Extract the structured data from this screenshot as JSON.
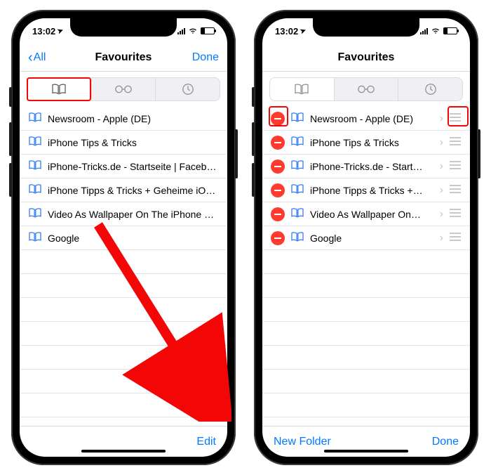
{
  "status": {
    "time": "13:02",
    "location_arrow": "➤"
  },
  "colors": {
    "tint": "#007aff",
    "delete": "#ff3b30",
    "highlight": "#f30606"
  },
  "left_phone": {
    "nav": {
      "back": "All",
      "title": "Favourites",
      "done": "Done"
    },
    "tabs": [
      "bookmarks",
      "reading-list",
      "history"
    ],
    "items": [
      {
        "title": "Newsroom - Apple (DE)"
      },
      {
        "title": "iPhone Tips & Tricks"
      },
      {
        "title": "iPhone-Tricks.de - Startseite | Facebo…"
      },
      {
        "title": "iPhone Tipps & Tricks + Geheime iOS…"
      },
      {
        "title": "Video As Wallpaper On The iPhone Lo…"
      },
      {
        "title": "Google"
      }
    ],
    "toolbar": {
      "edit": "Edit"
    }
  },
  "right_phone": {
    "nav": {
      "title": "Favourites"
    },
    "tabs": [
      "bookmarks",
      "reading-list",
      "history"
    ],
    "items": [
      {
        "title": "Newsroom - Apple (DE)"
      },
      {
        "title": "iPhone Tips & Tricks"
      },
      {
        "title": "iPhone-Tricks.de - Start…"
      },
      {
        "title": "iPhone Tipps & Tricks +…"
      },
      {
        "title": "Video As Wallpaper On…"
      },
      {
        "title": "Google"
      }
    ],
    "toolbar": {
      "new_folder": "New Folder",
      "done": "Done"
    }
  }
}
